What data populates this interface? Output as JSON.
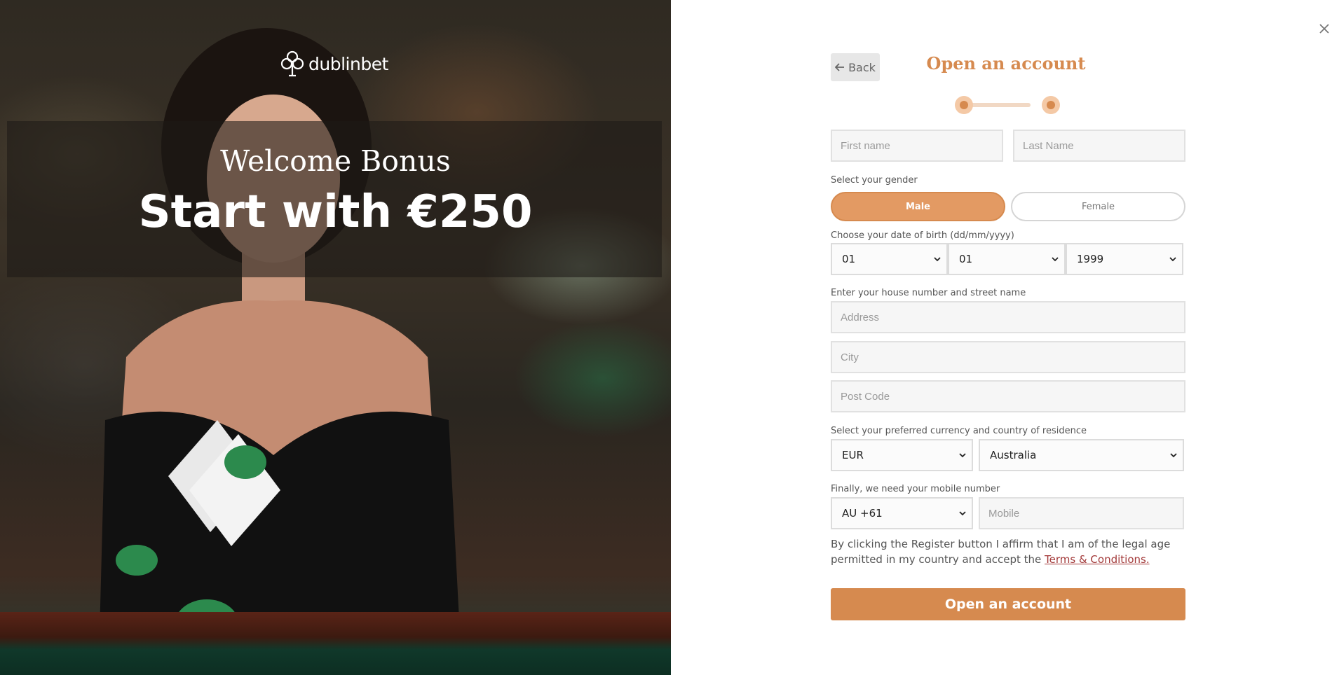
{
  "hero": {
    "logo_text": "dublinbet",
    "bonus_title": "Welcome Bonus",
    "bonus_amount": "Start with €250"
  },
  "form": {
    "close_icon": "close-icon",
    "back_label": "Back",
    "title": "Open an account",
    "progress": {
      "current_step": 2,
      "total_steps": 2
    },
    "first_name": {
      "placeholder": "First name",
      "value": ""
    },
    "last_name": {
      "placeholder": "Last Name",
      "value": ""
    },
    "gender": {
      "label": "Select your gender",
      "options": [
        "Male",
        "Female"
      ],
      "selected": "Male"
    },
    "dob": {
      "label": "Choose your date of birth (dd/mm/yyyy)",
      "day": "01",
      "month": "01",
      "year": "1999"
    },
    "address": {
      "label": "Enter your house number and street name",
      "placeholder": "Address",
      "value": ""
    },
    "city": {
      "placeholder": "City",
      "value": ""
    },
    "postcode": {
      "placeholder": "Post Code",
      "value": ""
    },
    "currency_country": {
      "label": "Select your preferred currency and country of residence",
      "currency": "EUR",
      "country": "Australia"
    },
    "mobile": {
      "label": "Finally, we need your mobile number",
      "prefix": "AU +61",
      "placeholder": "Mobile",
      "value": ""
    },
    "legal": {
      "text": "By clicking the Register button I affirm that I am of the legal age permitted in my country and accept the ",
      "link": "Terms & Conditions."
    },
    "submit_label": "Open an account"
  },
  "colors": {
    "accent": "#d68a4f",
    "accent_light": "#f4c9a6",
    "link": "#a33a3a"
  }
}
